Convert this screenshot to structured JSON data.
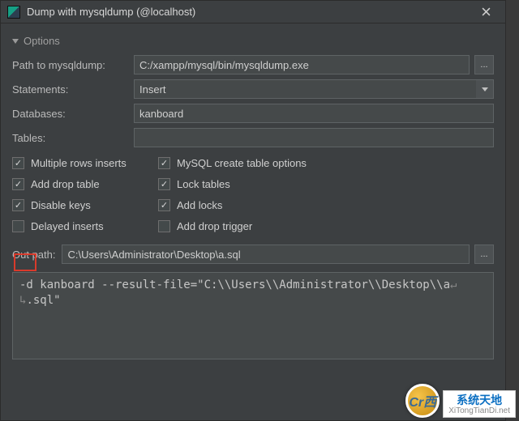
{
  "window": {
    "title": "Dump with mysqldump (@localhost)"
  },
  "options_header": "Options",
  "path_label": "Path to mysqldump:",
  "path_value": "C:/xampp/mysql/bin/mysqldump.exe",
  "statements_label": "Statements:",
  "statements_value": "Insert",
  "databases_label": "Databases:",
  "databases_value": "kanboard",
  "tables_label": "Tables:",
  "tables_value": "",
  "checks_left": [
    {
      "label": "Multiple rows inserts",
      "on": true
    },
    {
      "label": "Add drop table",
      "on": true
    },
    {
      "label": "Disable keys",
      "on": true
    },
    {
      "label": "Delayed inserts",
      "on": false
    }
  ],
  "checks_right": [
    {
      "label": "MySQL create table options",
      "on": true
    },
    {
      "label": "Lock tables",
      "on": true
    },
    {
      "label": "Add locks",
      "on": true
    },
    {
      "label": "Add drop trigger",
      "on": false
    }
  ],
  "outpath_label": "Out path:",
  "outpath_value": "C:\\Users\\Administrator\\Desktop\\a.sql",
  "command_line1": "-d kanboard --result-file=\"C:\\\\Users\\\\Administrator\\\\Desktop\\\\a",
  "command_line2": ".sql\"",
  "more_btn": "...",
  "watermark": {
    "badge": "Cr西",
    "cn": "系统天地",
    "url": "XiTongTianDi.net"
  }
}
